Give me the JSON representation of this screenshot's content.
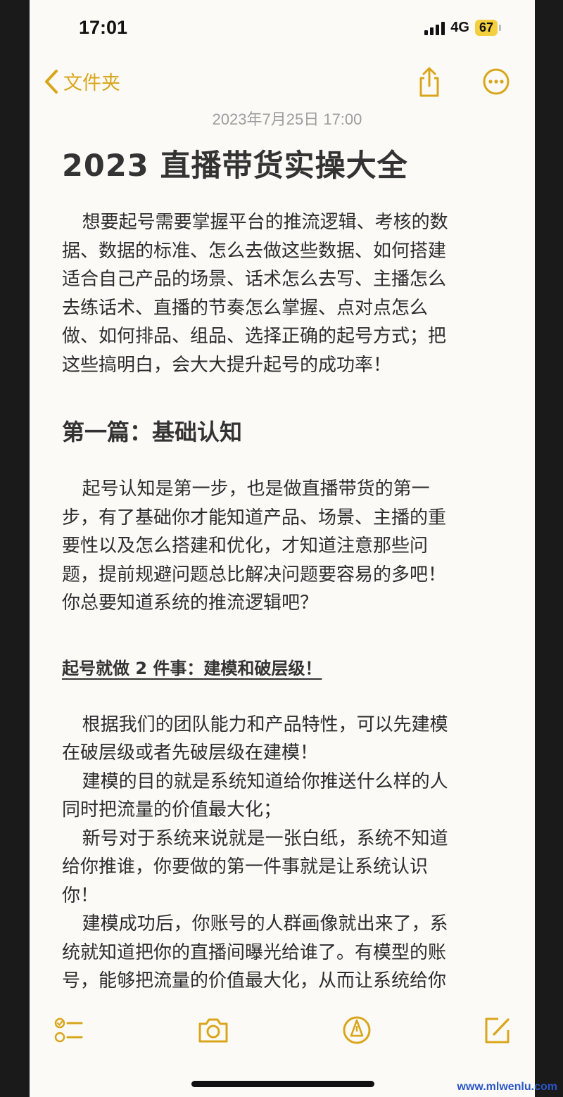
{
  "status_bar": {
    "time": "17:01",
    "network": "4G",
    "battery": "67"
  },
  "nav": {
    "back_label": "文件夹",
    "back_icon": "chevron-left-icon",
    "share_icon": "share-icon",
    "more_icon": "more-icon"
  },
  "note": {
    "date": "2023年7月25日 17:00",
    "title": "2023 直播带货实操大全",
    "paragraph_1_lines": [
      "想要起号需要掌握平台的推流逻辑、考核的数",
      "据、数据的标准、怎么去做这些数据、如何搭建",
      "适合自己产品的场景、话术怎么去写、主播怎么",
      "去练话术、直播的节奏怎么掌握、点对点怎么",
      "做、如何排品、组品、选择正确的起号方式；把",
      "这些搞明白，会大大提升起号的成功率！"
    ],
    "heading_1": "第一篇：基础认知",
    "paragraph_2_lines": [
      "起号认知是第一步，也是做直播带货的第一",
      "步，有了基础你才能知道产品、场景、主播的重",
      "要性以及怎么搭建和优化，才知道注意那些问",
      "题，提前规避问题总比解决问题要容易的多吧！",
      "你总要知道系统的推流逻辑吧？"
    ],
    "heading_2": "起号就做 2 件事：建模和破层级！",
    "paragraph_3_lines": [
      "根据我们的团队能力和产品特性，可以先建模",
      "在破层级或者先破层级在建模！",
      "建模的目的就是系统知道给你推送什么样的人",
      "同时把流量的价值最大化；",
      "新号对于系统来说就是一张白纸，系统不知道",
      "给你推谁，你要做的第一件事就是让系统认识",
      "你！",
      "建模成功后，你账号的人群画像就出来了，系",
      "统就知道把你的直播间曝光给谁了。有模型的账",
      "号，能够把流量的价值最大化，从而让系统给你"
    ]
  },
  "toolbar": {
    "checklist_icon": "checklist-icon",
    "camera_icon": "camera-icon",
    "markup_icon": "markup-pen-icon",
    "compose_icon": "compose-icon"
  },
  "watermark": "www.mlwenlu.com",
  "colors": {
    "accent": "#d9a61b",
    "background": "#fbfaf7",
    "text": "#2d2d2d"
  }
}
